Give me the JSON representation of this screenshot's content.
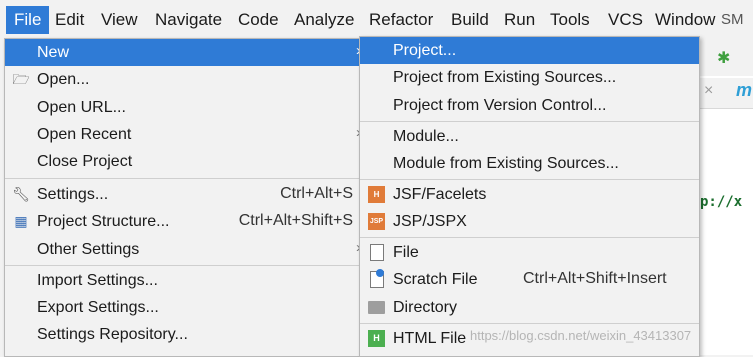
{
  "menubar": {
    "items": [
      {
        "label": "File"
      },
      {
        "label": "Edit"
      },
      {
        "label": "View"
      },
      {
        "label": "Navigate"
      },
      {
        "label": "Code"
      },
      {
        "label": "Analyze"
      },
      {
        "label": "Refactor"
      },
      {
        "label": "Build"
      },
      {
        "label": "Run"
      },
      {
        "label": "Tools"
      },
      {
        "label": "VCS"
      },
      {
        "label": "Window"
      },
      {
        "label": "SM"
      }
    ]
  },
  "file_menu": {
    "items": [
      {
        "label": "New",
        "shortcut": "",
        "submenu": true,
        "icon": ""
      },
      {
        "label": "Open...",
        "shortcut": "",
        "submenu": false,
        "icon": "folder-icon"
      },
      {
        "label": "Open URL...",
        "shortcut": "",
        "submenu": false,
        "icon": ""
      },
      {
        "label": "Open Recent",
        "shortcut": "",
        "submenu": true,
        "icon": ""
      },
      {
        "label": "Close Project",
        "shortcut": "",
        "submenu": false,
        "icon": ""
      },
      {
        "label": "Settings...",
        "shortcut": "Ctrl+Alt+S",
        "submenu": false,
        "icon": "wrench-icon"
      },
      {
        "label": "Project Structure...",
        "shortcut": "Ctrl+Alt+Shift+S",
        "submenu": false,
        "icon": "project-structure-icon"
      },
      {
        "label": "Other Settings",
        "shortcut": "",
        "submenu": true,
        "icon": ""
      },
      {
        "label": "Import Settings...",
        "shortcut": "",
        "submenu": false,
        "icon": ""
      },
      {
        "label": "Export Settings...",
        "shortcut": "",
        "submenu": false,
        "icon": ""
      },
      {
        "label": "Settings Repository...",
        "shortcut": "",
        "submenu": false,
        "icon": ""
      }
    ]
  },
  "new_submenu": {
    "items": [
      {
        "label": "Project...",
        "shortcut": "",
        "icon": ""
      },
      {
        "label": "Project from Existing Sources...",
        "shortcut": "",
        "icon": ""
      },
      {
        "label": "Project from Version Control...",
        "shortcut": "",
        "icon": ""
      },
      {
        "label": "Module...",
        "shortcut": "",
        "icon": ""
      },
      {
        "label": "Module from Existing Sources...",
        "shortcut": "",
        "icon": ""
      },
      {
        "label": "JSF/Facelets",
        "shortcut": "",
        "icon": "jsf-icon",
        "icon_text": "H"
      },
      {
        "label": "JSP/JSPX",
        "shortcut": "",
        "icon": "jsp-icon",
        "icon_text": "JSP"
      },
      {
        "label": "File",
        "shortcut": "",
        "icon": "file-icon"
      },
      {
        "label": "Scratch File",
        "shortcut": "Ctrl+Alt+Shift+Insert",
        "icon": "scratch-file-icon"
      },
      {
        "label": "Directory",
        "shortcut": "",
        "icon": "directory-icon"
      },
      {
        "label": "HTML File",
        "shortcut": "",
        "icon": "html-file-icon",
        "icon_text": "H"
      }
    ]
  },
  "editor": {
    "code_fragment": "p://x"
  },
  "watermark": "https://blog.csdn.net/weixin_43413307",
  "colors": {
    "selection": "#2f7bd6",
    "menu_bg": "#f2f2f2"
  }
}
